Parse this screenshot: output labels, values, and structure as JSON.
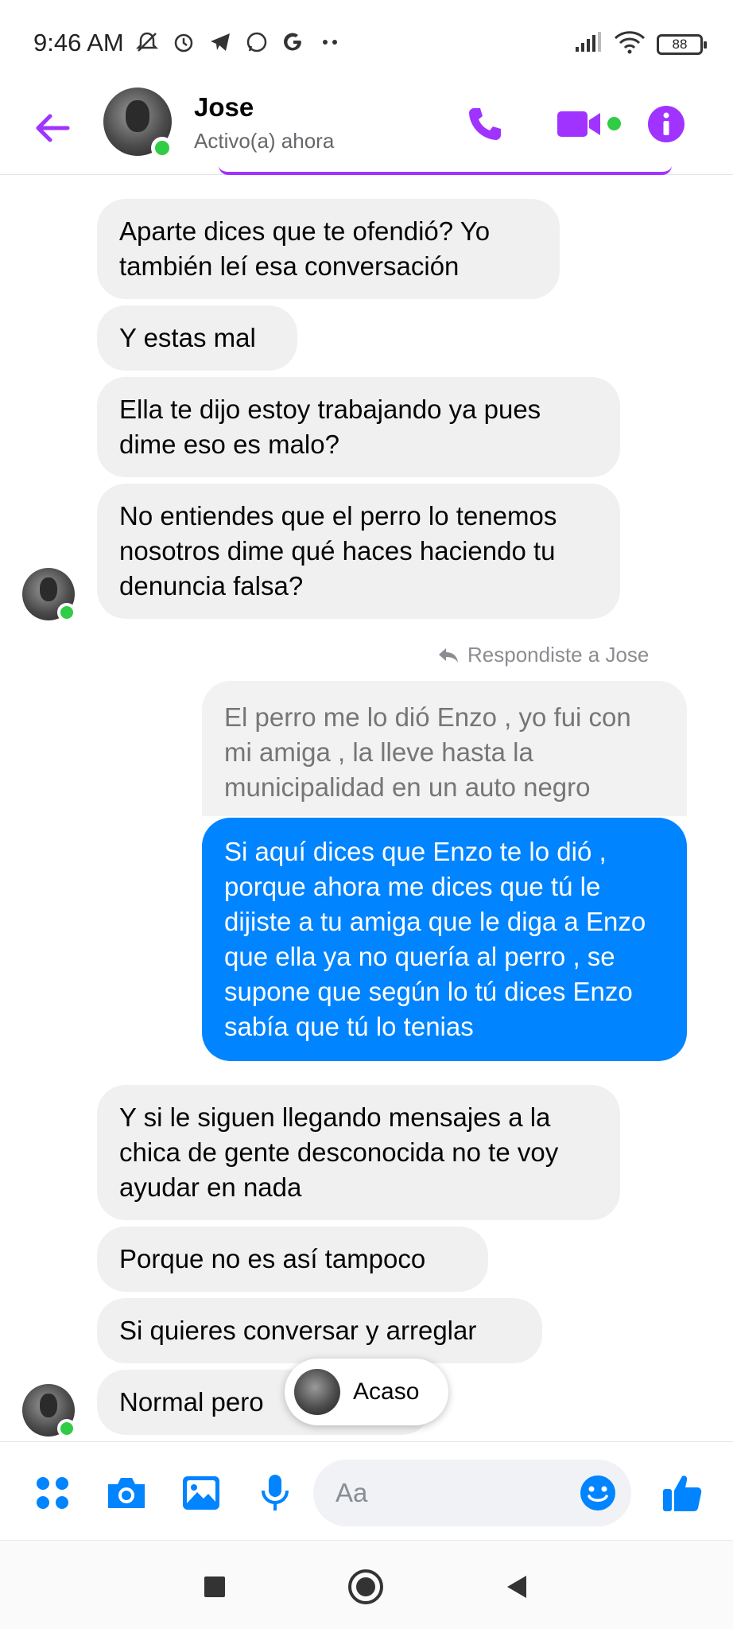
{
  "status_bar": {
    "time": "9:46 AM",
    "battery": "88"
  },
  "header": {
    "name": "Jose",
    "status": "Activo(a) ahora"
  },
  "messages_top": [
    "Aparte dices que te ofendió? Yo también leí esa conversación",
    "Y estas mal",
    "Ella te dijo estoy trabajando ya pues dime eso es malo?",
    "No entiendes que el perro lo tenemos nosotros dime qué haces haciendo tu denuncia falsa?"
  ],
  "reply_note": "Respondiste a Jose",
  "quoted_message": "El perro me lo dió Enzo , yo fui con mi amiga , la lleve hasta la municipalidad en un auto negro",
  "outgoing_message": "Si aquí dices que Enzo te lo dió , porque ahora me dices que tú le dijiste a tu amiga que le diga a Enzo que ella ya no quería al perro , se supone que según lo tú dices Enzo sabía que tú lo tenias",
  "messages_bottom": [
    "Y si le siguen llegando mensajes a la chica de gente desconocida no te voy ayudar en nada",
    "Porque no es así tampoco",
    "Si quieres conversar y arreglar",
    "Normal pero"
  ],
  "typing_tooltip": "Acaso",
  "composer": {
    "placeholder": "Aa"
  },
  "colors": {
    "accent_purple": "#a033ff",
    "accent_blue": "#0084ff",
    "online_green": "#31cc46"
  }
}
